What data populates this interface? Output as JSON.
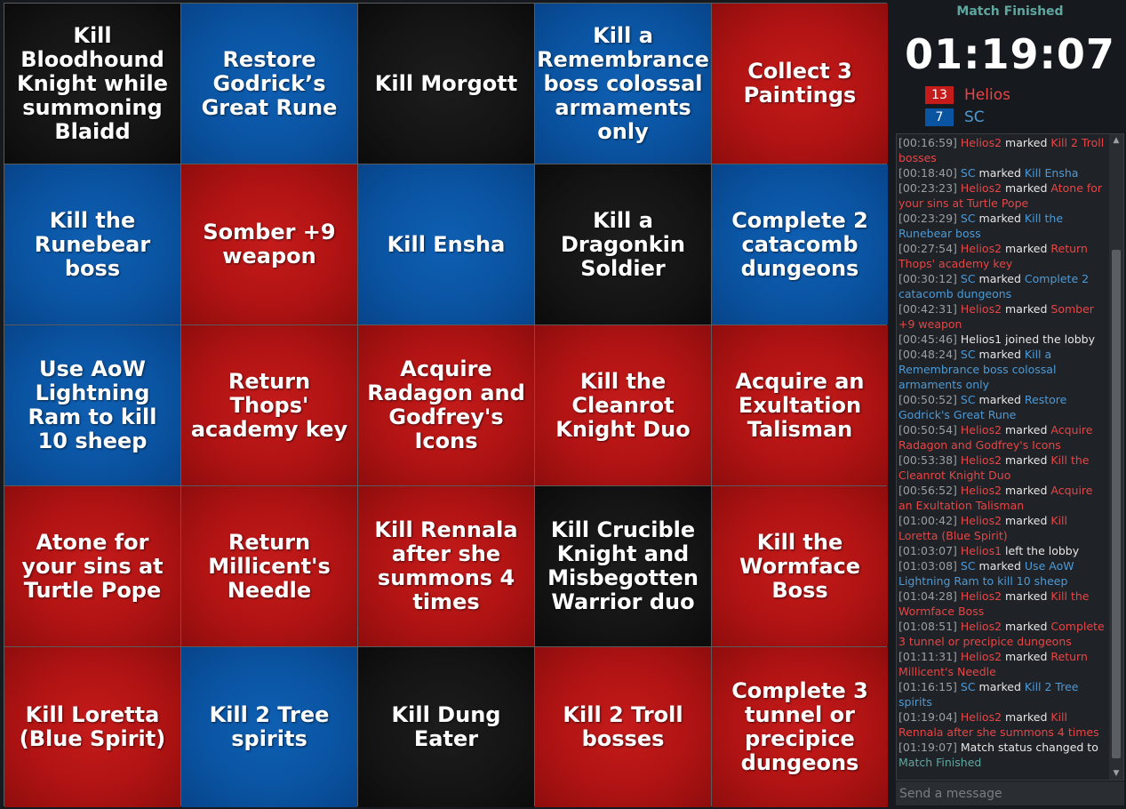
{
  "board": {
    "cells": [
      {
        "text": "Kill Bloodhound Knight while summoning Blaidd",
        "color": "black"
      },
      {
        "text": "Restore Godrick’s Great Rune",
        "color": "blue"
      },
      {
        "text": "Kill Morgott",
        "color": "black"
      },
      {
        "text": "Kill a Remembrance boss colossal armaments only",
        "color": "blue"
      },
      {
        "text": "Collect 3 Paintings",
        "color": "red"
      },
      {
        "text": "Kill the Runebear boss",
        "color": "blue"
      },
      {
        "text": "Somber +9 weapon",
        "color": "red"
      },
      {
        "text": "Kill Ensha",
        "color": "blue"
      },
      {
        "text": "Kill a Dragonkin Soldier",
        "color": "black"
      },
      {
        "text": "Complete 2 catacomb dungeons",
        "color": "blue"
      },
      {
        "text": "Use AoW Lightning Ram to kill 10 sheep",
        "color": "blue"
      },
      {
        "text": "Return Thops' academy key",
        "color": "red"
      },
      {
        "text": "Acquire Radagon and Godfrey's Icons",
        "color": "red"
      },
      {
        "text": "Kill the Cleanrot Knight Duo",
        "color": "red"
      },
      {
        "text": "Acquire an Exultation Talisman",
        "color": "red"
      },
      {
        "text": "Atone for your sins at Turtle Pope",
        "color": "red"
      },
      {
        "text": "Return Millicent's Needle",
        "color": "red"
      },
      {
        "text": "Kill Rennala after she summons 4 times",
        "color": "red"
      },
      {
        "text": "Kill Crucible Knight and Misbegotten Warrior duo",
        "color": "black"
      },
      {
        "text": "Kill the Wormface Boss",
        "color": "red"
      },
      {
        "text": "Kill Loretta (Blue Spirit)",
        "color": "red"
      },
      {
        "text": "Kill 2 Tree spirits",
        "color": "blue"
      },
      {
        "text": "Kill Dung Eater",
        "color": "black"
      },
      {
        "text": "Kill 2 Troll bosses",
        "color": "red"
      },
      {
        "text": "Complete 3 tunnel or precipice dungeons",
        "color": "red"
      }
    ]
  },
  "sidebar": {
    "status": "Match Finished",
    "timer": "01:19:07",
    "teams": [
      {
        "score": "13",
        "name": "Helios",
        "color": "#e84545",
        "badge": "#c51b1b"
      },
      {
        "score": "7",
        "name": "SC",
        "color": "#4d9ad6",
        "badge": "#0a54a2"
      }
    ]
  },
  "chat": {
    "placeholder": "Send a message",
    "lines": [
      {
        "t": "[00:16:59]",
        "parts": [
          [
            "Helios2",
            "red"
          ],
          [
            " marked ",
            "white"
          ],
          [
            "Kill 2 Troll bosses",
            "red"
          ]
        ]
      },
      {
        "t": "[00:18:40]",
        "parts": [
          [
            "SC",
            "blue"
          ],
          [
            " marked ",
            "white"
          ],
          [
            "Kill Ensha",
            "blue"
          ]
        ]
      },
      {
        "t": "[00:23:23]",
        "parts": [
          [
            "Helios2",
            "red"
          ],
          [
            " marked ",
            "white"
          ],
          [
            "Atone for your sins at Turtle Pope",
            "red"
          ]
        ]
      },
      {
        "t": "[00:23:29]",
        "parts": [
          [
            "SC",
            "blue"
          ],
          [
            " marked ",
            "white"
          ],
          [
            "Kill the Runebear boss",
            "blue"
          ]
        ]
      },
      {
        "t": "[00:27:54]",
        "parts": [
          [
            "Helios2",
            "red"
          ],
          [
            " marked ",
            "white"
          ],
          [
            "Return Thops' academy key",
            "red"
          ]
        ]
      },
      {
        "t": "[00:30:12]",
        "parts": [
          [
            "SC",
            "blue"
          ],
          [
            " marked ",
            "white"
          ],
          [
            "Complete 2 catacomb dungeons",
            "blue"
          ]
        ]
      },
      {
        "t": "[00:42:31]",
        "parts": [
          [
            "Helios2",
            "red"
          ],
          [
            " marked ",
            "white"
          ],
          [
            "Somber +9 weapon",
            "red"
          ]
        ]
      },
      {
        "t": "[00:45:46]",
        "parts": [
          [
            "Helios1 joined the lobby",
            "white"
          ]
        ]
      },
      {
        "t": "[00:48:24]",
        "parts": [
          [
            "SC",
            "blue"
          ],
          [
            " marked ",
            "white"
          ],
          [
            "Kill a Remembrance boss colossal armaments only",
            "blue"
          ]
        ]
      },
      {
        "t": "[00:50:52]",
        "parts": [
          [
            "SC",
            "blue"
          ],
          [
            " marked ",
            "white"
          ],
          [
            "Restore Godrick's Great Rune",
            "blue"
          ]
        ]
      },
      {
        "t": "[00:50:54]",
        "parts": [
          [
            "Helios2",
            "red"
          ],
          [
            " marked ",
            "white"
          ],
          [
            "Acquire Radagon and Godfrey's Icons",
            "red"
          ]
        ]
      },
      {
        "t": "[00:53:38]",
        "parts": [
          [
            "Helios2",
            "red"
          ],
          [
            " marked ",
            "white"
          ],
          [
            "Kill the Cleanrot Knight Duo",
            "red"
          ]
        ]
      },
      {
        "t": "[00:56:52]",
        "parts": [
          [
            "Helios2",
            "red"
          ],
          [
            " marked ",
            "white"
          ],
          [
            "Acquire an Exultation Talisman",
            "red"
          ]
        ]
      },
      {
        "t": "[01:00:42]",
        "parts": [
          [
            "Helios2",
            "red"
          ],
          [
            " marked ",
            "white"
          ],
          [
            "Kill Loretta (Blue Spirit)",
            "red"
          ]
        ]
      },
      {
        "t": "[01:03:07]",
        "parts": [
          [
            "Helios1",
            "red"
          ],
          [
            " left the lobby",
            "white"
          ]
        ]
      },
      {
        "t": "[01:03:08]",
        "parts": [
          [
            "SC",
            "blue"
          ],
          [
            " marked ",
            "white"
          ],
          [
            "Use AoW Lightning Ram to kill 10 sheep",
            "blue"
          ]
        ]
      },
      {
        "t": "[01:04:28]",
        "parts": [
          [
            "Helios2",
            "red"
          ],
          [
            " marked ",
            "white"
          ],
          [
            "Kill the Wormface Boss",
            "red"
          ]
        ]
      },
      {
        "t": "[01:08:51]",
        "parts": [
          [
            "Helios2",
            "red"
          ],
          [
            " marked ",
            "white"
          ],
          [
            "Complete 3 tunnel or precipice dungeons",
            "red"
          ]
        ]
      },
      {
        "t": "[01:11:31]",
        "parts": [
          [
            "Helios2",
            "red"
          ],
          [
            " marked ",
            "white"
          ],
          [
            "Return Millicent's Needle",
            "red"
          ]
        ]
      },
      {
        "t": "[01:16:15]",
        "parts": [
          [
            "SC",
            "blue"
          ],
          [
            " marked ",
            "white"
          ],
          [
            "Kill 2 Tree spirits",
            "blue"
          ]
        ]
      },
      {
        "t": "[01:19:04]",
        "parts": [
          [
            "Helios2",
            "red"
          ],
          [
            " marked ",
            "white"
          ],
          [
            "Kill Rennala after she summons 4 times",
            "red"
          ]
        ]
      },
      {
        "t": "[01:19:07]",
        "parts": [
          [
            "Match status changed to ",
            "white"
          ],
          [
            "Match Finished",
            "teal"
          ]
        ]
      }
    ]
  },
  "icons": {
    "scroll_up": "▲",
    "scroll_down": "▼"
  }
}
